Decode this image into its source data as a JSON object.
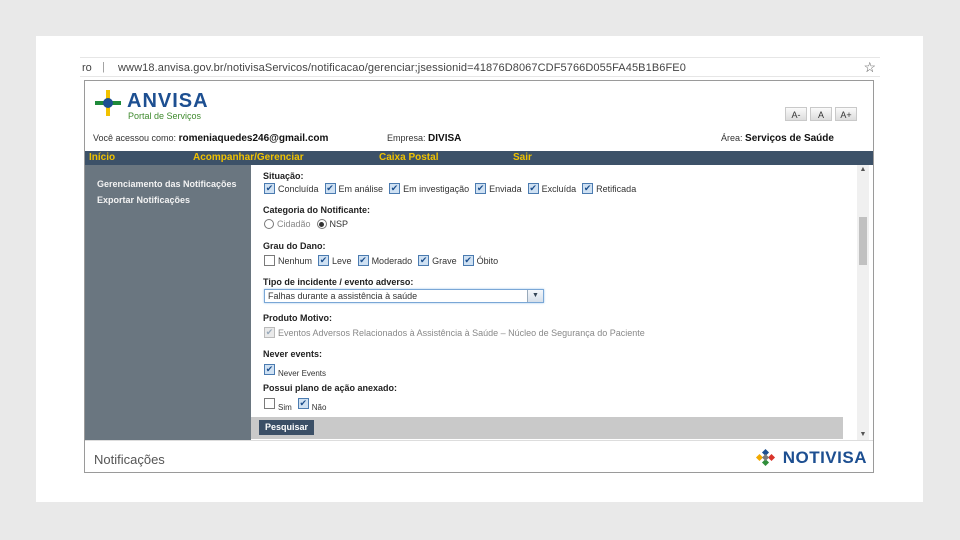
{
  "browser": {
    "lead": "ro",
    "url": "www18.anvisa.gov.br/notivisaServicos/notificacao/gerenciar;jsessionid=41876D8067CDF5766D055FA45B1B6FE0"
  },
  "header": {
    "brand": "ANVISA",
    "brand_sub": "Portal de Serviços",
    "font_buttons": [
      "A-",
      "A",
      "A+"
    ],
    "user_label": "Você acessou como:",
    "user_email": "romeniaquedes246@gmail.com",
    "company_label": "Empresa:",
    "company": "DIVISA",
    "area_label": "Área:",
    "area": "Serviços de Saúde"
  },
  "menu": [
    "Início",
    "Acompanhar/Gerenciar",
    "Caixa Postal",
    "Sair"
  ],
  "sidebar": {
    "items": [
      "Gerenciamento das Notificações",
      "Exportar Notificações"
    ]
  },
  "form": {
    "situacao": {
      "label": "Situação:",
      "options": [
        {
          "label": "Concluída",
          "checked": true
        },
        {
          "label": "Em análise",
          "checked": true
        },
        {
          "label": "Em investigação",
          "checked": true
        },
        {
          "label": "Enviada",
          "checked": true
        },
        {
          "label": "Excluída",
          "checked": true
        },
        {
          "label": "Retificada",
          "checked": true
        }
      ]
    },
    "categoria": {
      "label": "Categoria do Notificante:",
      "options": [
        {
          "label": "Cidadão",
          "selected": false
        },
        {
          "label": "NSP",
          "selected": true
        }
      ]
    },
    "grau": {
      "label": "Grau do Dano:",
      "options": [
        {
          "label": "Nenhum",
          "checked": false
        },
        {
          "label": "Leve",
          "checked": true
        },
        {
          "label": "Moderado",
          "checked": true
        },
        {
          "label": "Grave",
          "checked": true
        },
        {
          "label": "Óbito",
          "checked": true
        }
      ]
    },
    "tipo": {
      "label": "Tipo de incidente / evento adverso:",
      "value": "Falhas durante a assistência à saúde"
    },
    "produto": {
      "label": "Produto Motivo:",
      "option": "Eventos Adversos Relacionados à Assistência à Saúde – Núcleo de Segurança do Paciente"
    },
    "never": {
      "label": "Never events:",
      "option": "Never Events"
    },
    "plano": {
      "label": "Possui plano de ação anexado:",
      "options": [
        {
          "label": "Sim",
          "checked": false
        },
        {
          "label": "Não",
          "checked": true
        }
      ]
    },
    "search_button": "Pesquisar"
  },
  "footer": {
    "title": "Notificações",
    "logo_text": "NOTIVISA"
  },
  "colors": {
    "menu_bg": "#3c5168",
    "menu_text": "#f0c200",
    "sidebar_bg": "#6a7680",
    "brand": "#1d4f91"
  }
}
